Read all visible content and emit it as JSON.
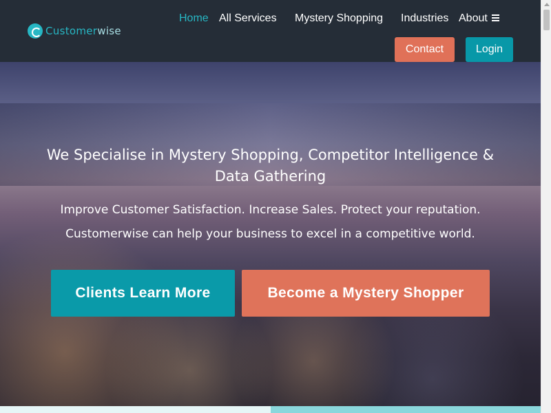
{
  "brand": {
    "logo_text_primary": "Customer",
    "logo_text_secondary": "wise",
    "accent_color": "#27b7c4",
    "header_color": "#252d37"
  },
  "nav": {
    "items": [
      {
        "label": "Home",
        "active": true
      },
      {
        "label": "All Services",
        "active": false
      },
      {
        "label": "Mystery Shopping",
        "active": false
      },
      {
        "label": "Industries",
        "active": false
      },
      {
        "label": "About",
        "active": false
      }
    ],
    "about_icon": "hamburger-icon",
    "contact_label": "Contact",
    "login_label": "Login",
    "contact_color": "#e07158",
    "login_color": "#0898a8"
  },
  "hero": {
    "title": "We Specialise in Mystery Shopping, Competitor Intelligence & Data Gathering",
    "line1": "Improve Customer Satisfaction. Increase Sales. Protect your reputation.",
    "line2": "Customerwise can help your business to excel in a competitive world.",
    "cta_clients": "Clients Learn More",
    "cta_shopper": "Become a Mystery Shopper",
    "cta_clients_color": "#0a9aa9",
    "cta_shopper_color": "#df735a"
  }
}
